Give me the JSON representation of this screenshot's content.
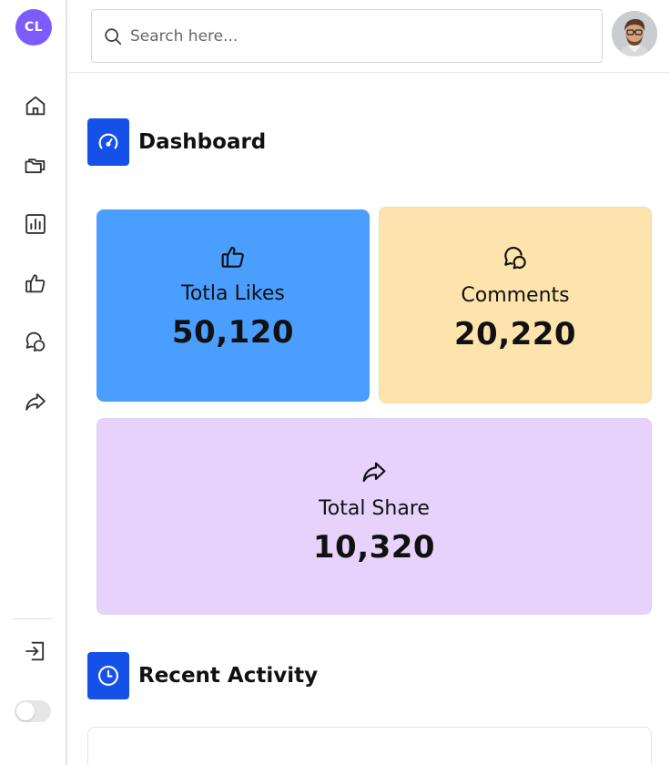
{
  "brand": {
    "initials": "CL",
    "color": "#7c5cff"
  },
  "sidebar": {
    "items": [
      {
        "name": "home",
        "icon": "home-icon"
      },
      {
        "name": "folders",
        "icon": "folders-icon"
      },
      {
        "name": "analytics",
        "icon": "bar-chart-icon"
      },
      {
        "name": "likes",
        "icon": "thumbs-up-icon"
      },
      {
        "name": "comments",
        "icon": "chat-bubbles-icon"
      },
      {
        "name": "share",
        "icon": "share-arrow-icon"
      }
    ],
    "logout_icon": "logout-icon",
    "theme_toggle": {
      "on": false
    }
  },
  "search": {
    "placeholder": "Search here...",
    "value": ""
  },
  "dashboard": {
    "title": "Dashboard",
    "accent": "#1550e8",
    "cards": [
      {
        "label": "Totla Likes",
        "value": "50,120",
        "color": "#4a9eff",
        "icon": "thumbs-up-icon"
      },
      {
        "label": "Comments",
        "value": "20,220",
        "color": "#fde4ad",
        "icon": "chat-bubbles-icon"
      },
      {
        "label": "Total Share",
        "value": "10,320",
        "color": "#e7d2fb",
        "icon": "share-arrow-icon"
      }
    ]
  },
  "recent_activity": {
    "title": "Recent Activity"
  }
}
